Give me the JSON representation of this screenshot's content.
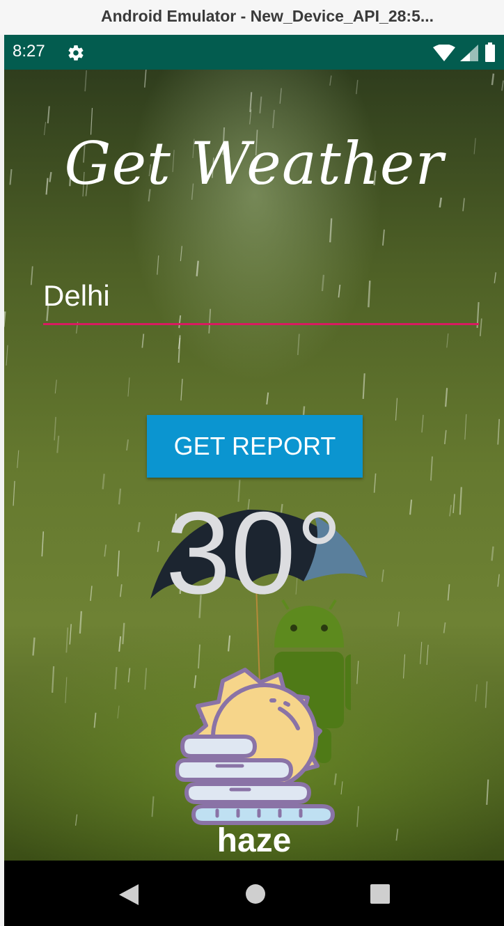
{
  "window": {
    "title": "Android Emulator - New_Device_API_28:5..."
  },
  "status_bar": {
    "time": "8:27",
    "icons": [
      "gear-icon",
      "wifi-icon",
      "cell-signal-icon",
      "battery-icon"
    ]
  },
  "app": {
    "title": "Get Weather",
    "city_input": {
      "value": "Delhi",
      "accent_color": "#d81b60"
    },
    "button_label": "GET REPORT",
    "button_color": "#0b95d0",
    "temperature": "30°",
    "weather_icon": "haze-icon",
    "description": "haze"
  },
  "nav_bar": {
    "buttons": [
      "back-icon",
      "home-icon",
      "recents-icon"
    ]
  }
}
